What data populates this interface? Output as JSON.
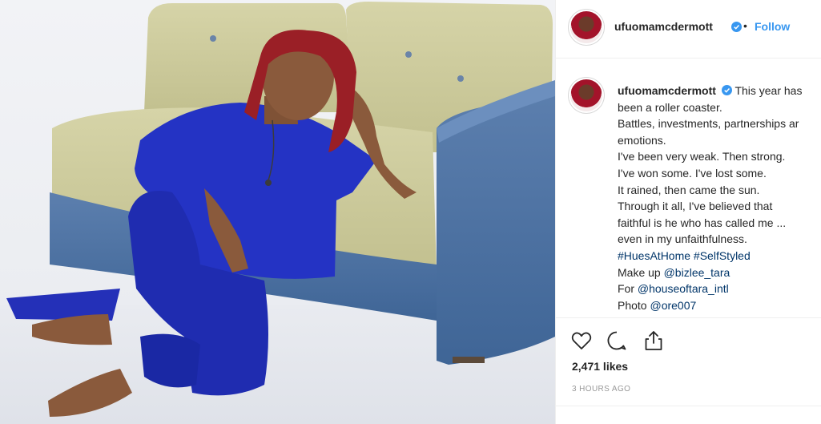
{
  "post": {
    "username": "ufuomamcdermott",
    "dot": "•",
    "follow_label": "Follow",
    "caption_lines": [
      "This year has",
      "been a roller coaster.",
      "Battles, investments, partnerships ar",
      "emotions.",
      "I've been very weak. Then strong.",
      "I've won some. I've lost some.",
      "It rained, then came the sun.",
      "Through it all, I've believed that",
      "faithful is he who has called me ...",
      "even in my unfaithfulness."
    ],
    "hashtags": "#HuesAtHome #SelfStyled",
    "makeup_prefix": "Make up ",
    "makeup_handle": "@bizlee_tara",
    "for_prefix": "For ",
    "for_handle": "@houseoftara_intl",
    "photo_prefix": "Photo ",
    "photo_handle": "@ore007",
    "likes": "2,471 likes",
    "time": "3 HOURS AGO"
  },
  "icons": {
    "like": "heart-icon",
    "comment": "speech-bubble-icon",
    "share": "share-icon",
    "verified": "verified-badge-icon"
  },
  "colors": {
    "link": "#3897f0",
    "hashtag": "#003569",
    "verified": "#3897f0",
    "text": "#262626",
    "muted": "#999999"
  }
}
